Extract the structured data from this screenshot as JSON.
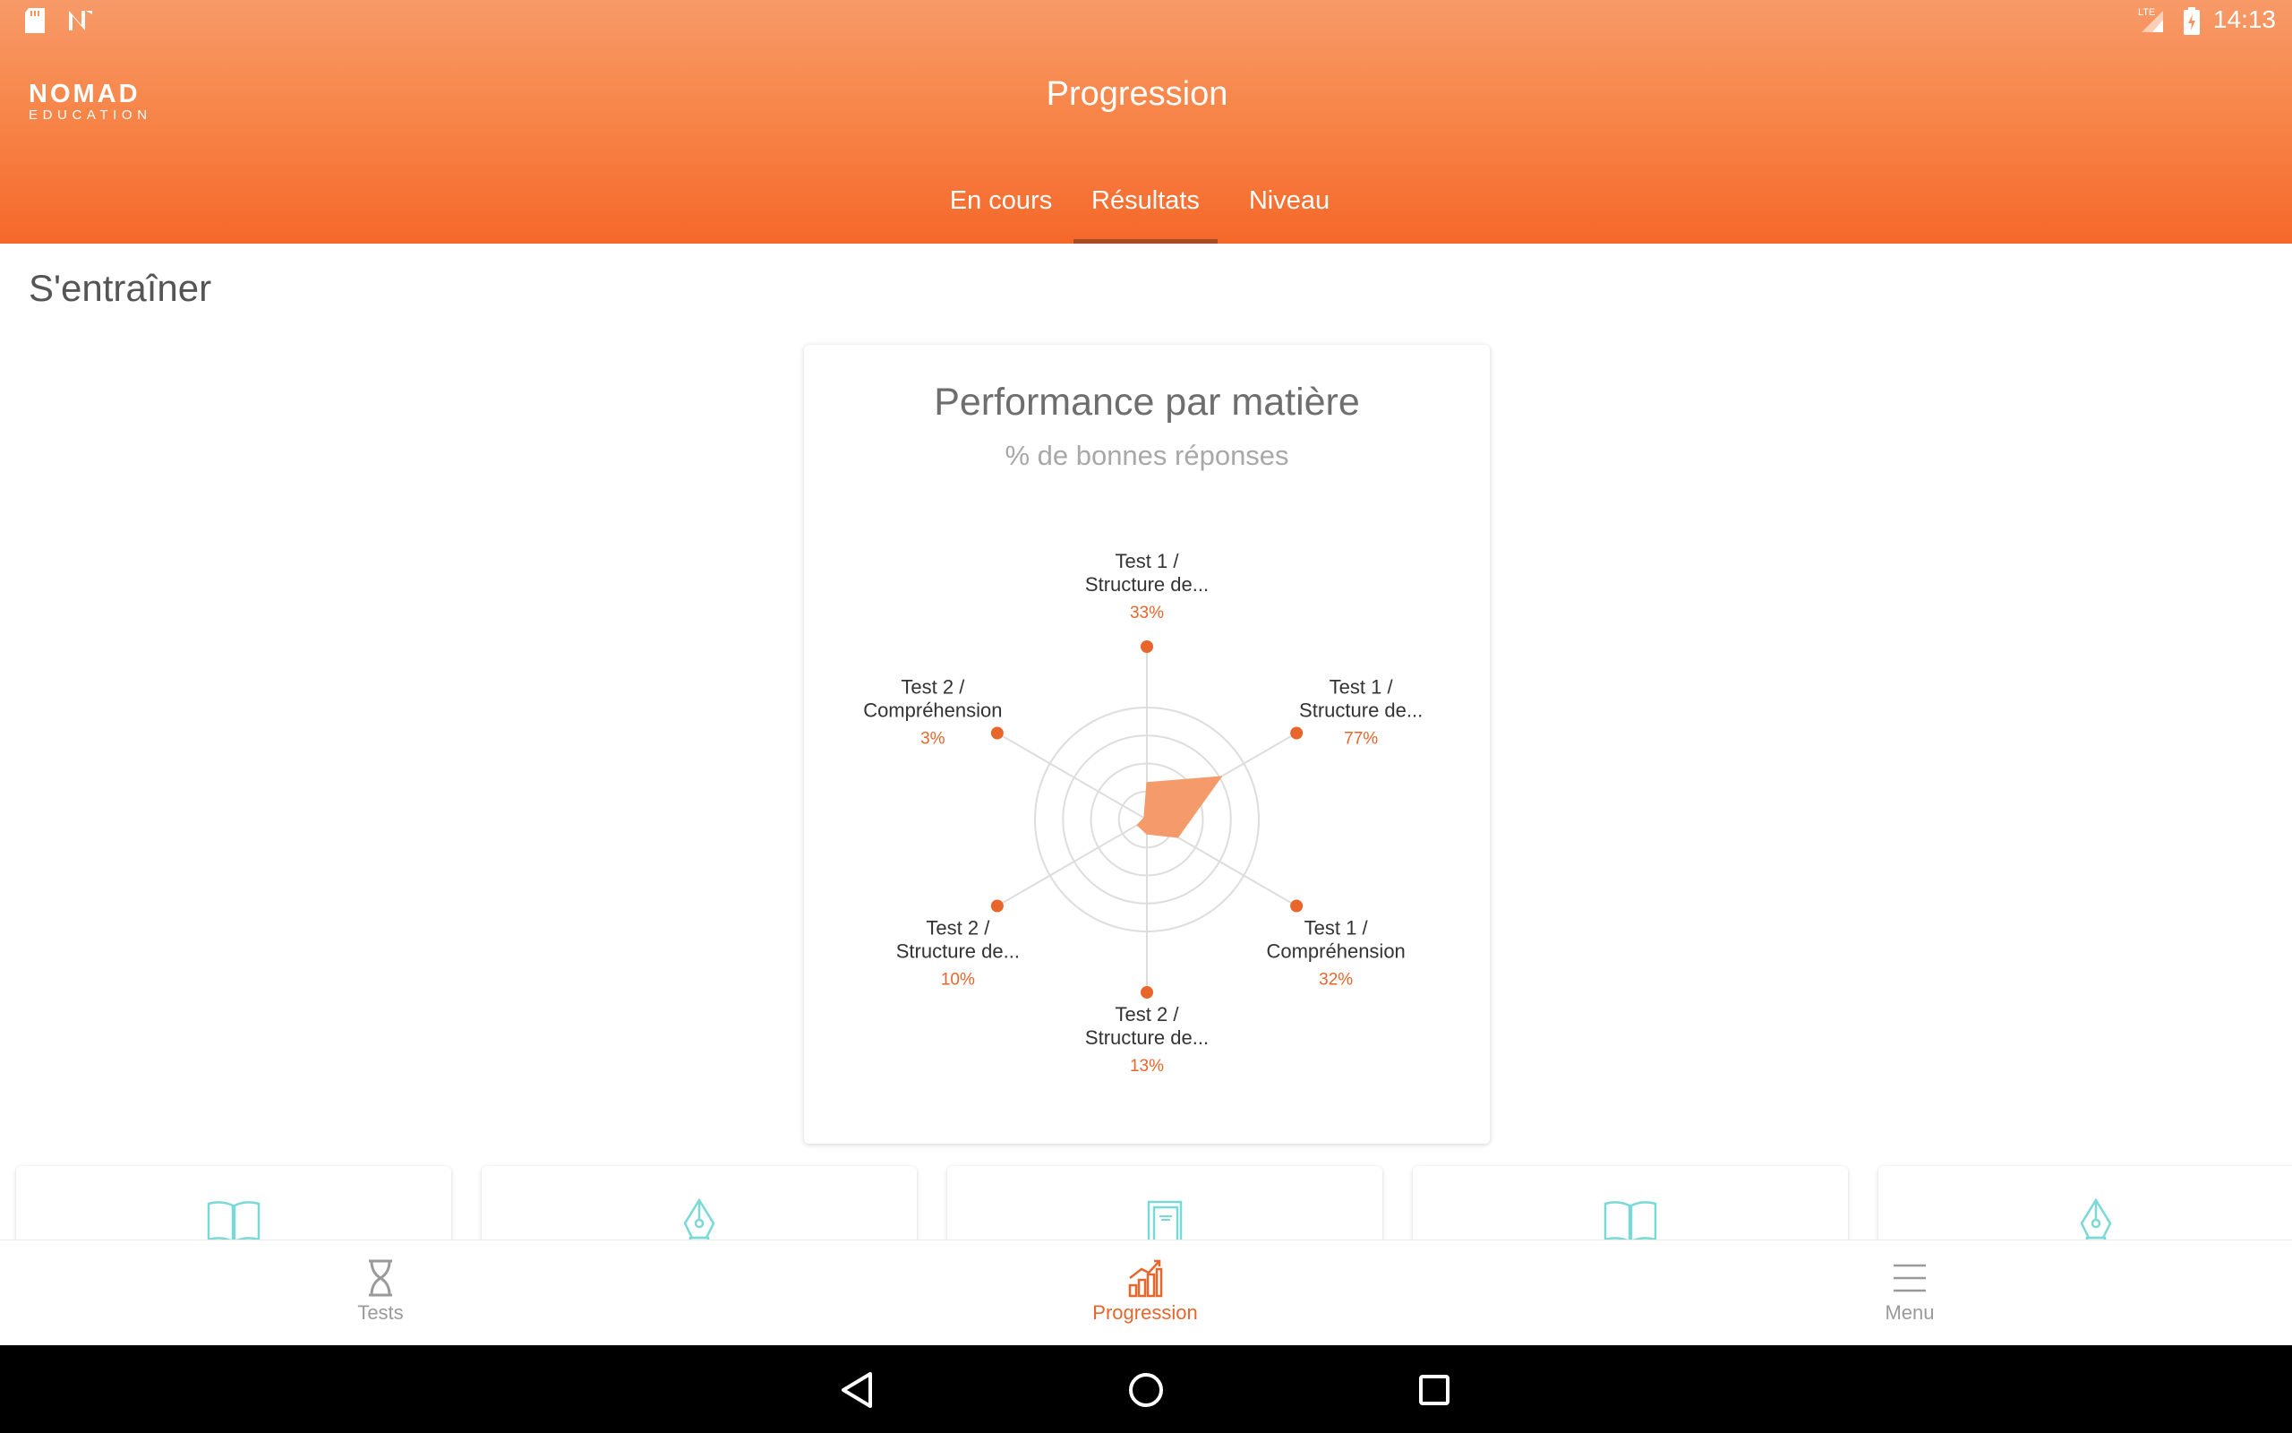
{
  "status_bar": {
    "time": "14:13",
    "network_label": "LTE",
    "left_icons": [
      "sd-card-icon",
      "nomad-notification-icon"
    ],
    "right_icons": [
      "signal-icon",
      "battery-charging-icon"
    ]
  },
  "header": {
    "logo_top": "NOMAD",
    "logo_bottom": "EDUCATION",
    "title": "Progression",
    "tabs": [
      {
        "label": "En cours",
        "active": false
      },
      {
        "label": "Résultats",
        "active": true
      },
      {
        "label": "Niveau",
        "active": false
      }
    ]
  },
  "section": {
    "title": "S'entraîner"
  },
  "chart_card": {
    "title": "Performance par matière",
    "subtitle": "% de bonnes réponses"
  },
  "chart_data": {
    "type": "radar",
    "title": "Performance par matière",
    "subtitle": "% de bonnes réponses",
    "range": [
      0,
      100
    ],
    "rings": 4,
    "axes": [
      {
        "line1": "Test 1 /",
        "line2": "Structure de...",
        "value": 33,
        "value_label": "33%"
      },
      {
        "line1": "Test 1 /",
        "line2": "Structure de...",
        "value": 77,
        "value_label": "77%"
      },
      {
        "line1": "Test 1 /",
        "line2": "Compréhension",
        "value": 32,
        "value_label": "32%"
      },
      {
        "line1": "Test 2 /",
        "line2": "Structure de...",
        "value": 13,
        "value_label": "13%"
      },
      {
        "line1": "Test 2 /",
        "line2": "Structure de...",
        "value": 10,
        "value_label": "10%"
      },
      {
        "line1": "Test 2 /",
        "line2": "Compréhension",
        "value": 3,
        "value_label": "3%"
      }
    ],
    "colors": {
      "fill": "#f59a6a",
      "point": "#e8652b",
      "value_text": "#e8652b",
      "label_text": "#333333",
      "grid": "#dddddd"
    }
  },
  "cards": [
    {
      "icon": "book-icon"
    },
    {
      "icon": "pen-nib-icon"
    },
    {
      "icon": "door-icon"
    },
    {
      "icon": "book-icon"
    },
    {
      "icon": "pen-nib-icon"
    }
  ],
  "bottom_nav": [
    {
      "label": "Tests",
      "icon": "hourglass-icon",
      "active": false
    },
    {
      "label": "Progression",
      "icon": "chart-icon",
      "active": true
    },
    {
      "label": "Menu",
      "icon": "menu-icon",
      "active": false
    }
  ],
  "android_nav": [
    "back-icon",
    "home-icon",
    "recents-icon"
  ],
  "colors": {
    "accent": "#e8652b",
    "header_top": "#f79a68",
    "header_bottom": "#f5682a",
    "card_icon": "#7ad9d6"
  }
}
